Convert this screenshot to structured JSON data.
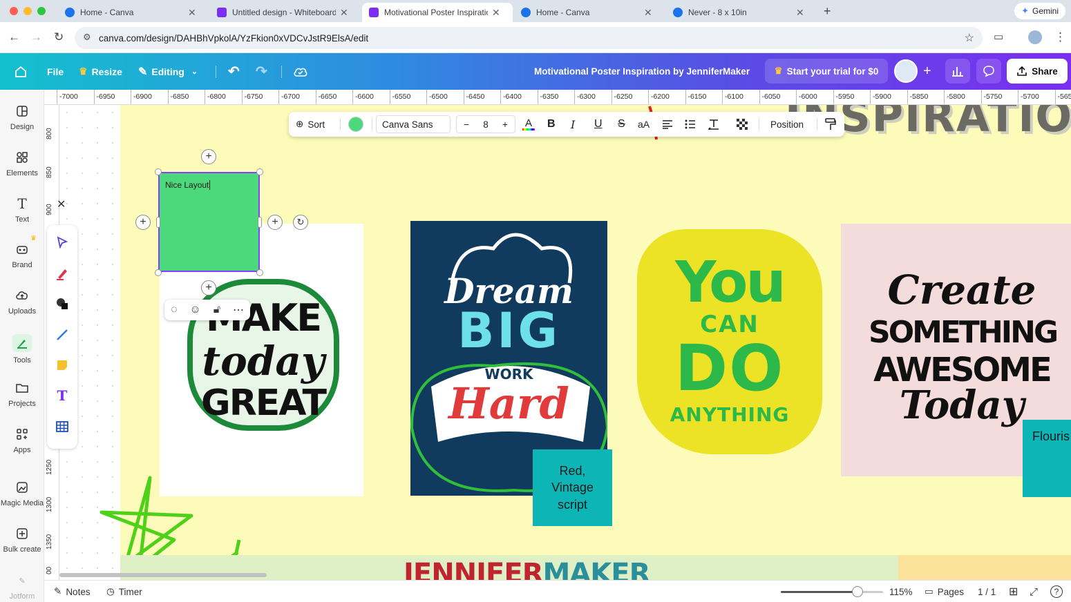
{
  "browser": {
    "tabs": [
      {
        "label": "Home - Canva",
        "active": false,
        "favicon_color": "#1a73e8"
      },
      {
        "label": "Untitled design - Whiteboard",
        "active": false,
        "favicon_color": "#7b2ff0"
      },
      {
        "label": "Motivational Poster Inspiratio",
        "active": true,
        "favicon_color": "#7b2ff0"
      },
      {
        "label": "Home - Canva",
        "active": false,
        "favicon_color": "#1a73e8"
      },
      {
        "label": "Never - 8 x 10in",
        "active": false,
        "favicon_color": "#1a73e8"
      }
    ],
    "new_tab": "+",
    "gemini_label": "Gemini",
    "url": "canva.com/design/DAHBhVpkolA/YzFkion0xVDCvJstR9ElsA/edit"
  },
  "canva_bar": {
    "file_label": "File",
    "resize_label": "Resize",
    "editing_label": "Editing",
    "document_title": "Motivational Poster Inspiration by JenniferMaker",
    "trial_label": "Start your trial for $0",
    "share_label": "Share"
  },
  "side_panel": [
    {
      "label": "Design",
      "icon": "design-icon"
    },
    {
      "label": "Elements",
      "icon": "elements-icon"
    },
    {
      "label": "Text",
      "icon": "text-icon"
    },
    {
      "label": "Brand",
      "icon": "brand-icon"
    },
    {
      "label": "Uploads",
      "icon": "uploads-icon"
    },
    {
      "label": "Tools",
      "icon": "tools-icon"
    },
    {
      "label": "Projects",
      "icon": "projects-icon"
    },
    {
      "label": "Apps",
      "icon": "apps-icon"
    },
    {
      "label": "Magic Media",
      "icon": "magic-media-icon"
    },
    {
      "label": "Bulk create",
      "icon": "bulk-create-icon"
    },
    {
      "label": "Jotform",
      "icon": "jotform-icon"
    }
  ],
  "ruler_top": [
    "-7000",
    "-6950",
    "-6900",
    "-6850",
    "-6800",
    "-6750",
    "-6700",
    "-6650",
    "-6600",
    "-6550",
    "-6500",
    "-6450",
    "-6400",
    "-6350",
    "-6300",
    "-6250",
    "-6200",
    "-6150",
    "-6100",
    "-6050",
    "-6000",
    "-5950",
    "-5900",
    "-5850",
    "-5800",
    "-5750",
    "-5700",
    "-565"
  ],
  "ruler_left": [
    "800",
    "850",
    "900",
    "1250",
    "1300",
    "1350",
    "00"
  ],
  "text_toolbar": {
    "sort_label": "Sort",
    "text_color": "#4cd97b",
    "font_name": "Canva Sans",
    "font_size": "8",
    "minus": "−",
    "plus": "+",
    "case_label": "aA",
    "position_label": "Position"
  },
  "selected_note": {
    "text": "Nice Layout",
    "color": "#4cd97b"
  },
  "sticky_notes": {
    "red_vintage": {
      "line1": "Red,",
      "line2": "Vintage",
      "line3": "script",
      "color": "#0db5b6"
    },
    "flourish": {
      "text": "Flouris",
      "color": "#0db5b6"
    }
  },
  "posters": {
    "make_today_great": {
      "line1": "MAKE",
      "line2": "today",
      "line3": "GREAT"
    },
    "dream_big": {
      "line1": "Dream",
      "line2": "BIG",
      "line3": "WORK",
      "line4": "Hard"
    },
    "you_can_do": {
      "line1": "You",
      "line2": "CAN",
      "line3": "DO",
      "line4": "ANYTHING"
    },
    "create_something": {
      "line1": "Create",
      "line2": "SOMETHING",
      "line3": "AWESOME",
      "line4": "Today"
    },
    "inspiration_header": "INSPIRATION IMAGES"
  },
  "watermark": {
    "part1": "JENNIFER",
    "part2": "MAKER",
    "color1": "#c0242f",
    "color2": "#2a8f9a"
  },
  "status_bar": {
    "notes_label": "Notes",
    "timer_label": "Timer",
    "zoom_label": "115%",
    "pages_label": "Pages",
    "page_count": "1 / 1",
    "zoom_level": 0.75
  },
  "colors": {
    "board": "#fdfbb9",
    "canva_gradient_start": "#14c0ce",
    "canva_gradient_end": "#7b2ff0",
    "selection": "#8b3dff"
  }
}
